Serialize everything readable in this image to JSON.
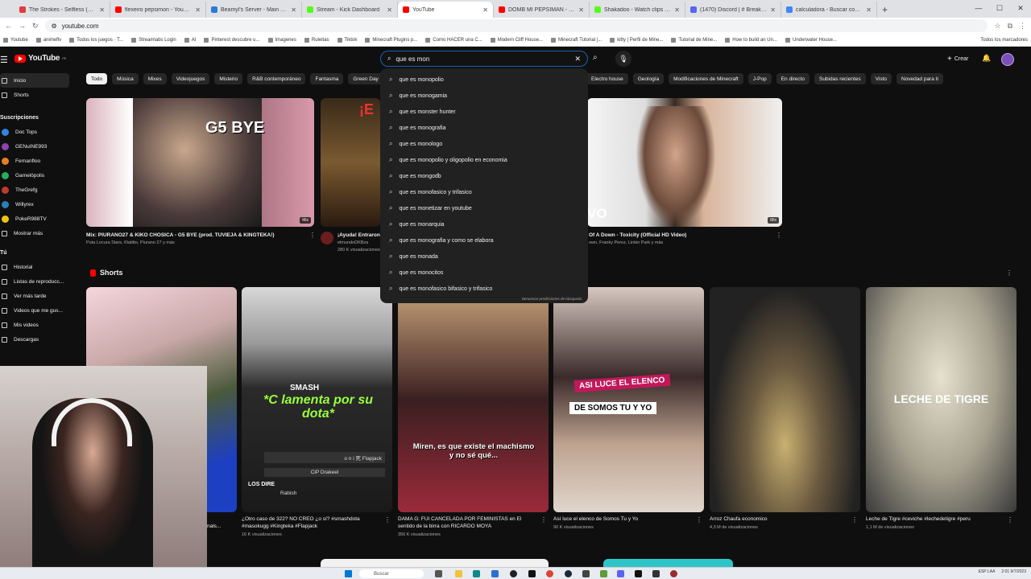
{
  "browser": {
    "tabs": [
      {
        "title": "The Strokes - Selfless (Lyrics + ...",
        "color": "#e33b3b"
      },
      {
        "title": "flexeiro pepsimon - YouTube",
        "color": "#ff0000"
      },
      {
        "title": "Beamyl's Server - Main Page",
        "color": "#2b7bd6"
      },
      {
        "title": "Stream - Kick Dashboard",
        "color": "#53fc18"
      },
      {
        "title": "YouTube",
        "color": "#ff0000"
      },
      {
        "title": "DOMB MI PEPSIMAN - YO...",
        "color": "#ff0000"
      },
      {
        "title": "Shakadoo - Watch clips on Ki...",
        "color": "#53fc18"
      },
      {
        "title": "(1470) Discord | # Breaking...",
        "color": "#5865f2"
      },
      {
        "title": "calculadora - Buscar con Google",
        "color": "#4285f4"
      }
    ],
    "url": "youtube.com",
    "bookmarks": [
      "Youtube",
      "animeflv",
      "Todos los juegos · T...",
      "Streamlabs Login",
      "AI",
      "Pinterest descubre u...",
      "Imagenes",
      "Ruleitas",
      "Tiktok",
      "Minecraft Plugins p...",
      "Como HACER una C...",
      "Modern Cliff House...",
      "Minecraft Tutorial |...",
      "kitty | Perfil de Mine...",
      "Tutorial de Mine...",
      "How to build an Un...",
      "Underwater House..."
    ],
    "all_bookmarks": "Todos los marcadores"
  },
  "yt": {
    "logo_text": "YouTube",
    "logo_country": "PE",
    "search_value": "que es mon",
    "create_label": "Crear",
    "sidebar": {
      "items": [
        "Inicio",
        "Shorts"
      ],
      "subs_header": "Suscripciones",
      "channels": [
        {
          "name": "Doc Tops",
          "color": "#2e86de"
        },
        {
          "name": "GENuINE993",
          "color": "#8e44ad"
        },
        {
          "name": "Fernanfloo",
          "color": "#e67e22"
        },
        {
          "name": "Gamelöpolis",
          "color": "#27ae60"
        },
        {
          "name": "TheGrefg",
          "color": "#c0392b"
        },
        {
          "name": "Willyrex",
          "color": "#2980b9"
        },
        {
          "name": "PokeR988TV",
          "color": "#f1c40f"
        }
      ],
      "show_more": "Mostrar más",
      "you_header": "Tú",
      "you_items": [
        "Historial",
        "Listas de reproducc...",
        "Ver más tarde",
        "Videos que me gus...",
        "Mis videos",
        "Descargas"
      ]
    },
    "chips": [
      "Todo",
      "Música",
      "Mixes",
      "Videojuegos",
      "Misterio",
      "R&B contemporáneo",
      "Fantasma",
      "Green Day"
    ],
    "chips_right": [
      "Electro house",
      "Geología",
      "Modificaciones de Minecraft",
      "J-Pop",
      "En directo",
      "Subidas recientes",
      "Visto",
      "Novedad para ti"
    ],
    "suggestions": [
      "que es monopolio",
      "que es monogamia",
      "que es monster hunter",
      "que es monografia",
      "que es monologo",
      "que es monopolio y oligopolio en economia",
      "que es mongodb",
      "que es monofasico y trifasico",
      "que es monetizar en youtube",
      "que es monarquia",
      "que es monografia y como se elabora",
      "que es monada",
      "que es monocitos",
      "que es monofasico bifasico y trifasico"
    ],
    "report": "Denunciar predicciones de búsqueda",
    "videos": [
      {
        "title": "Mix: PIURANO27 & KIKO CHOSICA - G5 BYE (prod. TUVIEJA & KINGTEKA!)",
        "meta": "Puta Locura Stars, Klatitto, Piurano 27 y más",
        "badge": "Mix",
        "thumb_text": "G5 BYE"
      },
      {
        "title": "¡Ayuda! Entraron",
        "meta1": "elmundoDKBza",
        "meta2": "280 K visualizaciones",
        "thumb_text": "¡E"
      },
      {
        "title": "Of A Down - Toxicity (Official HD Video)",
        "meta": "own, Franky Perez, Linkin Park y más",
        "badge": "Mix",
        "thumb_text": "VO"
      }
    ],
    "shorts_header": "Shorts",
    "shorts": [
      {
        "title": "nals...",
        "meta": ""
      },
      {
        "title": "¿Otro caso de 322? NO CREO ¿o sí? #smashdota",
        "title2": "#masokugg #Kingteka #Flapjack",
        "meta": "16 K visualizaciones",
        "overlay": "*C lamenta por su dota*",
        "top": "SMASH",
        "rows": [
          "o n i 死 Flapjack",
          "CiP Drakeel",
          "LOS DIRE",
          "Rabish"
        ]
      },
      {
        "title": "DAMA G: FUI CANCELADA POR FEMINISTAS en El",
        "title2": "sentido de la birra con RICARDO MOYA",
        "meta": "356 K visualizaciones",
        "overlay": "Miren, es que existe el machismo y no sé qué..."
      },
      {
        "title": "Así luce el elenco de Somos Tu y Yo",
        "meta": "90 K visualizaciones",
        "overlay1": "ASI LUCE EL ELENCO",
        "overlay2": "DE SOMOS TU Y YO"
      },
      {
        "title": "Arroz Chaufa economico",
        "meta": "4,3 M de visualizaciones"
      },
      {
        "title": "Leche de Tigre #ceviche #lechedetigre #peru",
        "meta": "1,1 M de visualizaciones",
        "overlay": "LECHE DE TIGRE"
      }
    ]
  },
  "taskbar": {
    "search": "Buscar",
    "lang": "ESP",
    "region": "LAA",
    "time": "2:01",
    "date": "9/7/2023"
  }
}
